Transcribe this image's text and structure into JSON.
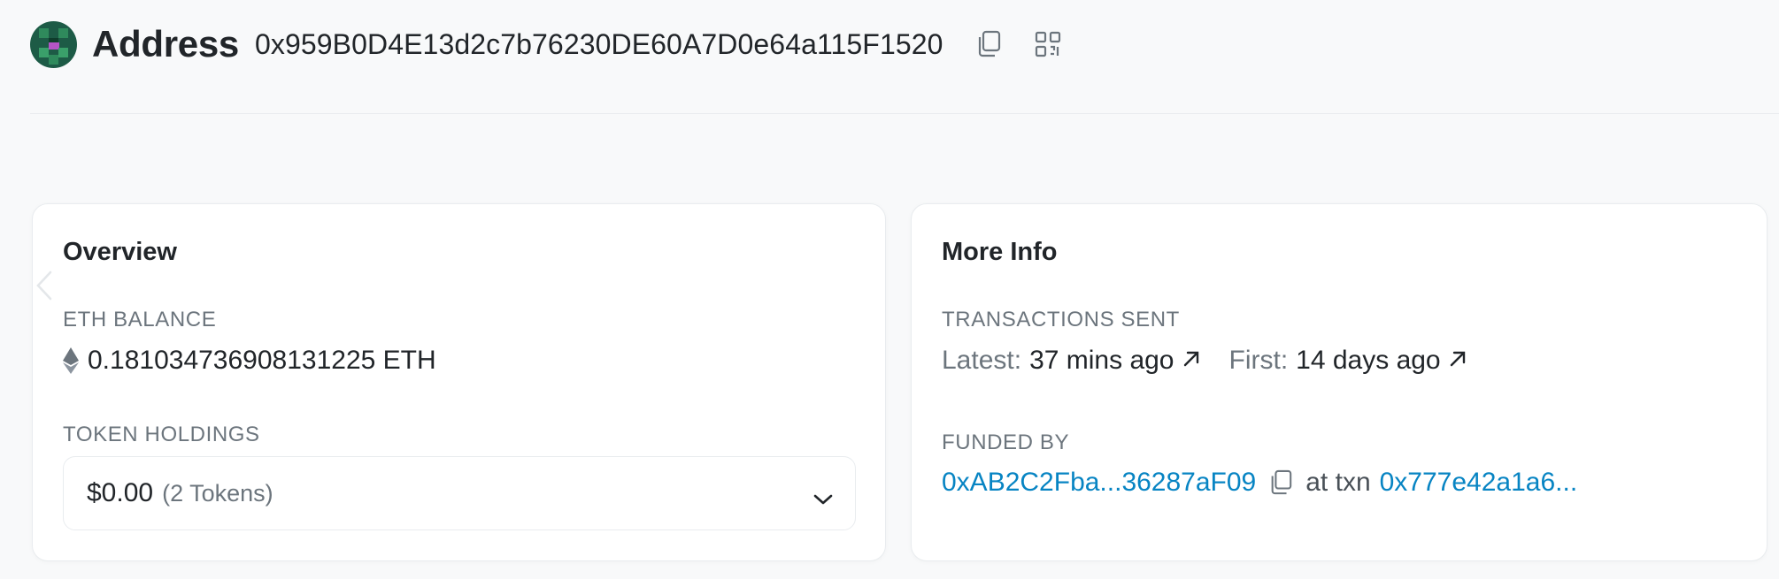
{
  "header": {
    "title": "Address",
    "address": "0x959B0D4E13d2c7b76230DE60A7D0e64a115F1520",
    "copy_icon": "copy-icon",
    "qr_icon": "qr-code-icon"
  },
  "overview": {
    "title": "Overview",
    "eth_balance_label": "ETH BALANCE",
    "eth_balance_value": "0.181034736908131225 ETH",
    "token_holdings_label": "TOKEN HOLDINGS",
    "token_holdings_value": "$0.00",
    "token_holdings_count": "(2 Tokens)"
  },
  "more_info": {
    "title": "More Info",
    "transactions_sent_label": "TRANSACTIONS SENT",
    "latest_label": "Latest:",
    "latest_value": "37 mins ago",
    "first_label": "First:",
    "first_value": "14 days ago",
    "funded_by_label": "FUNDED BY",
    "funded_by_address": "0xAB2C2Fba...36287aF09",
    "at_txn_label": "at txn",
    "txn_hash": "0x777e42a1a6..."
  },
  "colors": {
    "accent_link": "#0784c3",
    "muted_text": "#6c757d",
    "page_bg": "#f8f9fa"
  }
}
